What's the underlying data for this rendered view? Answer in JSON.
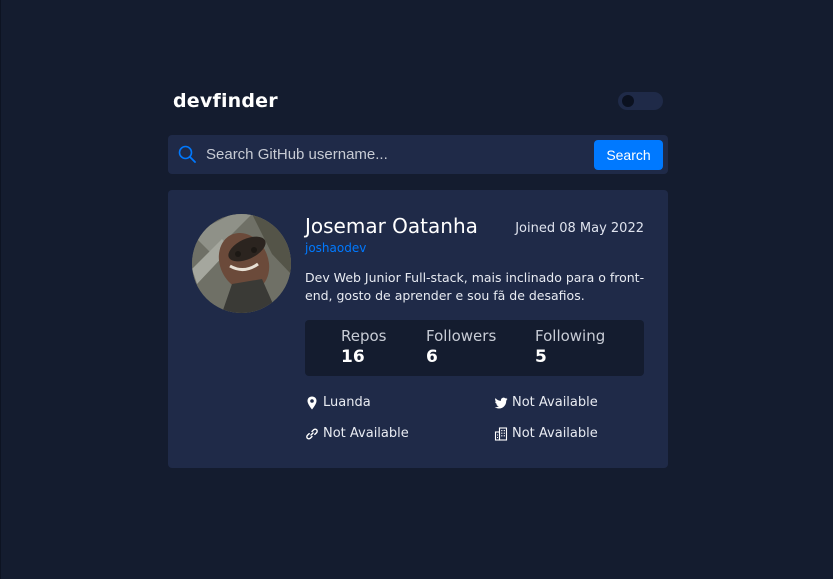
{
  "app": {
    "logo": "devfinder",
    "theme_toggle": "dark-mode"
  },
  "search": {
    "placeholder": "Search GitHub username...",
    "value": "",
    "button_label": "Search",
    "icon": "search-icon"
  },
  "profile": {
    "name": "Josemar Oatanha",
    "login": "joshaodev",
    "joined": "Joined 08 May 2022",
    "bio": "Dev Web Junior Full-stack, mais inclinado para o front-end, gosto de aprender e sou fã de desafios.",
    "avatar": "avatar-photo"
  },
  "stats": [
    {
      "label": "Repos",
      "value": "16"
    },
    {
      "label": "Followers",
      "value": "6"
    },
    {
      "label": "Following",
      "value": "5"
    }
  ],
  "info": {
    "location": {
      "icon": "location-pin-icon",
      "text": "Luanda"
    },
    "twitter": {
      "icon": "twitter-icon",
      "text": "Not Available"
    },
    "website": {
      "icon": "link-icon",
      "text": "Not Available"
    },
    "company": {
      "icon": "building-icon",
      "text": "Not Available"
    }
  },
  "colors": {
    "background": "#141c2f",
    "card": "#1f2a48",
    "accent": "#0079ff",
    "text": "#ffffff"
  }
}
